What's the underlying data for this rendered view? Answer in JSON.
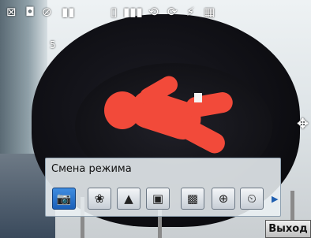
{
  "status_bar": {
    "icons": [
      "close-icon",
      "camera-mode-icon",
      "timer-off-icon",
      "battery-icon",
      "sd-card-icon",
      "signal-icon",
      "rotate-icon",
      "sync-icon",
      "flash-off-icon",
      "quality-icon"
    ],
    "count_label": "5"
  },
  "mode_panel": {
    "title": "Смена режима",
    "modes": [
      "camera-icon",
      "flower-macro-icon",
      "landscape-icon",
      "frame-icon",
      "contrast-icon",
      "zoom-icon",
      "timer-icon"
    ],
    "active_index": 0
  },
  "softkeys": {
    "right": "Выход"
  },
  "colors": {
    "accent": "#1a5fb8",
    "panel_bg": "#ebf0f4"
  }
}
